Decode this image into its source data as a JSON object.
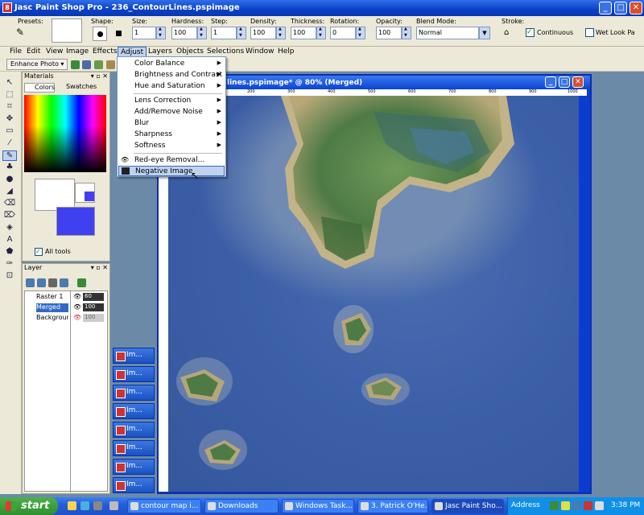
{
  "app": {
    "title": "Jasc Paint Shop Pro - 236_ContourLines.pspimage",
    "icon": "psp-app-icon"
  },
  "window_controls": {
    "min": "_",
    "max": "□",
    "close": "✕"
  },
  "tool_options": {
    "presets_label": "Presets:",
    "shape_label": "Shape:",
    "size": {
      "label": "Size:",
      "value": "1"
    },
    "hardness": {
      "label": "Hardness:",
      "value": "100"
    },
    "step": {
      "label": "Step:",
      "value": "1"
    },
    "density": {
      "label": "Density:",
      "value": "100"
    },
    "thickness": {
      "label": "Thickness:",
      "value": "100"
    },
    "rotation": {
      "label": "Rotation:",
      "value": "0"
    },
    "opacity": {
      "label": "Opacity:",
      "value": "100"
    },
    "blend_mode": {
      "label": "Blend Mode:",
      "value": "Normal"
    },
    "stroke": {
      "label": "Stroke:",
      "continuous": "Continuous",
      "wet_look": "Wet Look Pa"
    }
  },
  "menubar": [
    "File",
    "Edit",
    "View",
    "Image",
    "Effects",
    "Adjust",
    "Layers",
    "Objects",
    "Selections",
    "Window",
    "Help"
  ],
  "toolbar3": {
    "enhance_photo": "Enhance Photo ▾"
  },
  "materials": {
    "title": "Materials",
    "tab_colors": "Colors",
    "tab_swatches": "Swatches",
    "all_tools": "All tools"
  },
  "layers": {
    "title": "Layer",
    "rows": [
      {
        "name": "Raster 1",
        "opacity": "60"
      },
      {
        "name": "Merged",
        "opacity": "100"
      },
      {
        "name": "Backgrour",
        "opacity": "100"
      }
    ]
  },
  "canvas": {
    "title": "lines.pspimage* @  80% (Merged)",
    "ruler_ticks": [
      "100",
      "200",
      "300",
      "400",
      "500",
      "600",
      "700",
      "800",
      "900",
      "1000"
    ]
  },
  "adjust_menu": [
    {
      "label": "Color Balance",
      "sub": true
    },
    {
      "label": "Brightness and Contrast",
      "sub": true
    },
    {
      "label": "Hue and Saturation",
      "sub": true
    },
    {
      "label": "Lens Correction",
      "sub": true
    },
    {
      "label": "Add/Remove Noise",
      "sub": true
    },
    {
      "label": "Blur",
      "sub": true
    },
    {
      "label": "Sharpness",
      "sub": true
    },
    {
      "label": "Softness",
      "sub": true
    },
    {
      "label": "Red-eye Removal...",
      "sub": false
    },
    {
      "label": "Negative Image",
      "sub": false
    }
  ],
  "image_tabs": [
    "Im...",
    "Im...",
    "Im...",
    "Im...",
    "Im...",
    "Im...",
    "Im...",
    "Im..."
  ],
  "taskbar": {
    "start": "start",
    "buttons": [
      "contour map i...",
      "Downloads",
      "Windows Task...",
      "3. Patrick O'He...",
      "Jasc Paint Sho..."
    ],
    "address": "Address",
    "clock": "3:38 PM"
  },
  "colors": {
    "accent": "#316ac5",
    "titlebar": "#0a3fc8",
    "face": "#ece9d8",
    "fg_swatch": "#ffffff",
    "bg_swatch": "#4040f0"
  }
}
